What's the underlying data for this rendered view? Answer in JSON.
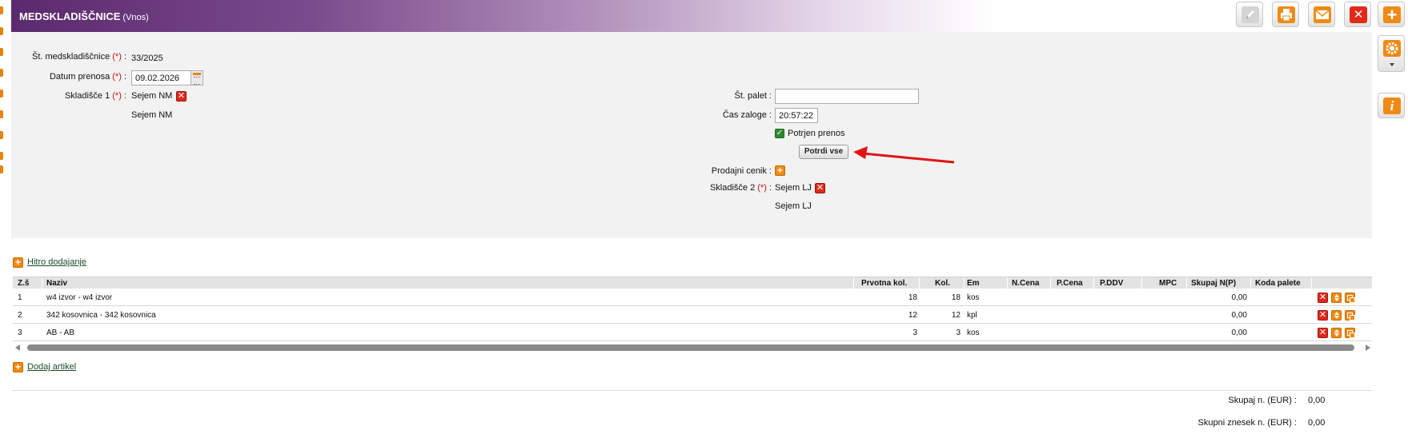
{
  "header": {
    "title": "MEDSKLADIŠČNICE",
    "subtitle": "(Vnos)"
  },
  "toolbar": {
    "edit_icon": "pencil-icon",
    "print_icon": "printer-icon",
    "mail_icon": "mail-icon",
    "close_icon": "close-icon",
    "add_icon": "plus-icon",
    "settings_icon": "gear-icon",
    "info_icon": "info-icon",
    "info_glyph": "i"
  },
  "form": {
    "st_medskladiscnice_label": "Št. medskladiščnice",
    "st_medskladiscnice_value": "33/2025",
    "datum_prenosa_label": "Datum prenosa",
    "datum_prenosa_value": "09.02.2026",
    "skladisce1_label": "Skladišče 1",
    "skladisce1_value": "Sejem NM",
    "skladisce1_value2": "Sejem NM",
    "required_mark": "(*)",
    "colon": ":",
    "st_palet_label": "Št. palet :",
    "st_palet_value": "",
    "cas_zaloge_label": "Čas zaloge :",
    "cas_zaloge_value": "20:57:22",
    "potrjen_prenos_label": "Potrjen prenos",
    "potrdi_vse_label": "Potrdi vse",
    "prodajni_cenik_label": "Prodajni cenik :",
    "skladisce2_label": "Skladišče 2",
    "skladisce2_value": "Sejem LJ",
    "skladisce2_value2": "Sejem LJ"
  },
  "links": {
    "hitro_dodajanje": "Hitro dodajanje",
    "dodaj_artikel": "Dodaj artikel"
  },
  "table": {
    "columns": [
      "Z.š",
      "Naziv",
      "Prvotna kol.",
      "Kol.",
      "Em",
      "N.Cena",
      "P.Cena",
      "P.DDV",
      "MPC",
      "Skupaj N(P)",
      "Koda palete"
    ],
    "rows": [
      {
        "zs": "1",
        "naziv": "w4 izvor - w4 izvor",
        "prvotna": "18",
        "kol": "18",
        "em": "kos",
        "skupaj": "0,00"
      },
      {
        "zs": "2",
        "naziv": "342 kosovnica - 342 kosovnica",
        "prvotna": "12",
        "kol": "12",
        "em": "kpl",
        "skupaj": "0,00"
      },
      {
        "zs": "3",
        "naziv": "AB - AB",
        "prvotna": "3",
        "kol": "3",
        "em": "kos",
        "skupaj": "0,00"
      }
    ]
  },
  "totals": {
    "skupaj_label": "Skupaj n. (EUR) :",
    "skupaj_value": "0,00",
    "skupni_znesek_label": "Skupni znesek n. (EUR) :",
    "skupni_znesek_value": "0,00"
  },
  "glyphs": {
    "x": "✕",
    "plus": "+",
    "check": "✓"
  },
  "colors": {
    "header_start": "#5b2a6e",
    "accent_orange": "#f08a14",
    "danger_red": "#e02a1a",
    "arrow_red": "#e01515"
  }
}
